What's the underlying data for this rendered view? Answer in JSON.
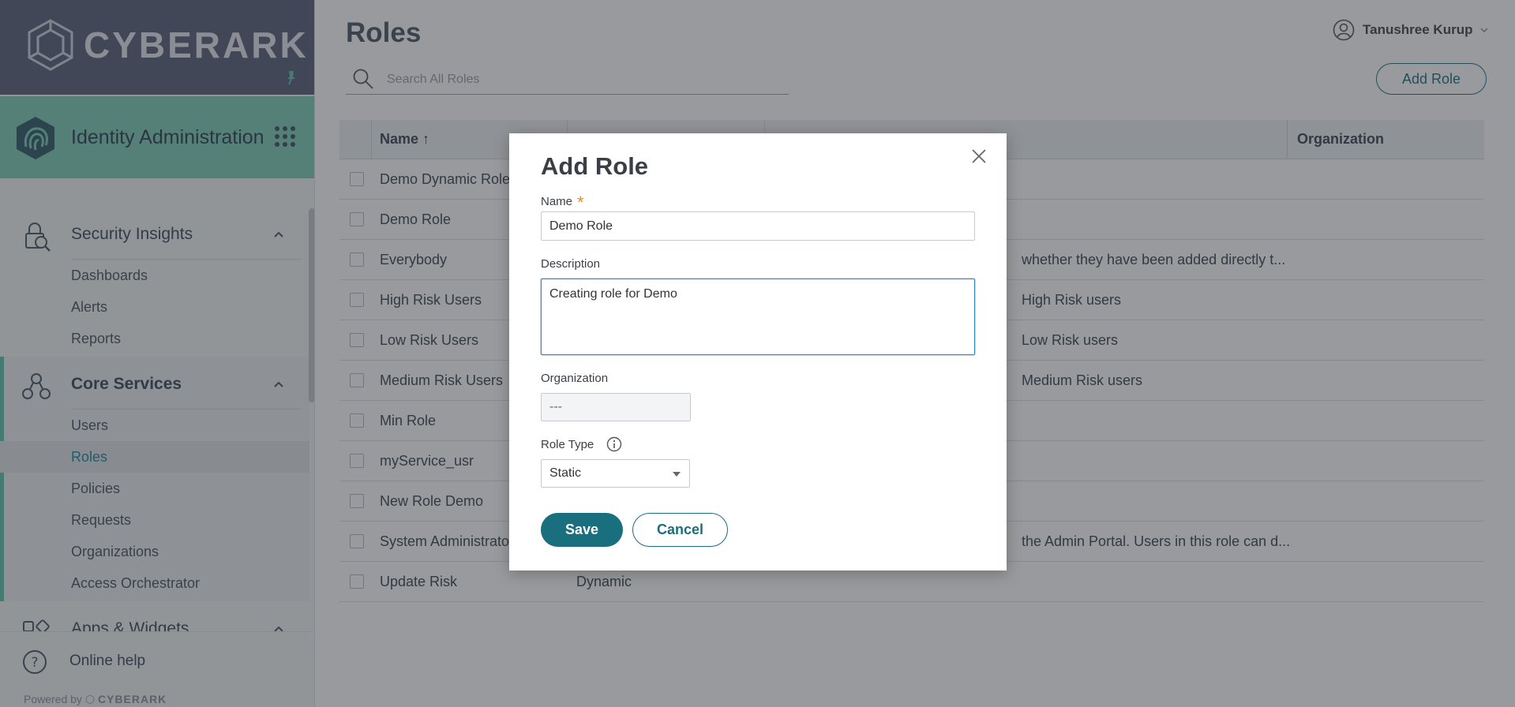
{
  "brand": {
    "logo_text": "CYBERARK",
    "colors": {
      "header": "#58607a",
      "app_bar": "#7dcdb9",
      "accent": "#1a6f7e"
    }
  },
  "app": {
    "name": "Identity Administration"
  },
  "nav": {
    "sections": [
      {
        "label": "Security Insights",
        "icon": "security-insights-icon",
        "items": [
          "Dashboards",
          "Alerts",
          "Reports"
        ]
      },
      {
        "label": "Core Services",
        "icon": "core-services-icon",
        "items": [
          "Users",
          "Roles",
          "Policies",
          "Requests",
          "Organizations",
          "Access Orchestrator"
        ]
      },
      {
        "label": "Apps & Widgets",
        "icon": "apps-widgets-icon"
      }
    ],
    "active_item": "Roles",
    "help_label": "Online help",
    "powered_by": "Powered by",
    "powered_brand": "CYBERARK"
  },
  "header": {
    "title": "Roles",
    "user_name": "Tanushree Kurup",
    "search_placeholder": "Search All Roles",
    "add_role_label": "Add Role"
  },
  "table": {
    "columns": {
      "name": "Name ↑",
      "organization": "Organization"
    },
    "rows": [
      {
        "name": "Demo Dynamic Role",
        "type": "",
        "description": ""
      },
      {
        "name": "Demo Role",
        "type": "",
        "description": ""
      },
      {
        "name": "Everybody",
        "type": "",
        "description": "whether they have been added directly t..."
      },
      {
        "name": "High Risk Users",
        "type": "",
        "description": "High Risk users"
      },
      {
        "name": "Low Risk Users",
        "type": "",
        "description": "Low Risk users"
      },
      {
        "name": "Medium Risk Users",
        "type": "",
        "description": "Medium Risk users"
      },
      {
        "name": "Min Role",
        "type": "",
        "description": ""
      },
      {
        "name": "myService_usr",
        "type": "",
        "description": ""
      },
      {
        "name": "New Role Demo",
        "type": "",
        "description": ""
      },
      {
        "name": "System Administrator",
        "type": "",
        "description": "the Admin Portal. Users in this role can d..."
      },
      {
        "name": "Update Risk",
        "type": "Dynamic",
        "description": ""
      }
    ]
  },
  "modal": {
    "title": "Add Role",
    "name_label": "Name",
    "required_mark": "*",
    "name_value": "Demo Role",
    "description_label": "Description",
    "description_value": "Creating role for Demo",
    "organization_label": "Organization",
    "organization_value": "---",
    "role_type_label": "Role Type",
    "role_type_value": "Static",
    "save_label": "Save",
    "cancel_label": "Cancel"
  }
}
